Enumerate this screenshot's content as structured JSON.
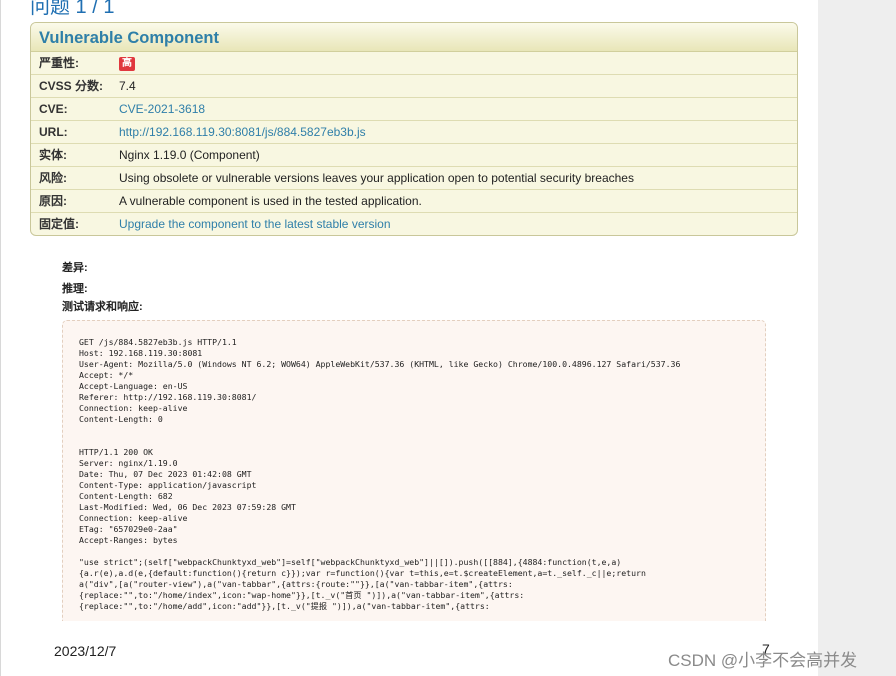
{
  "top_heading": "问题 1 / 1",
  "vuln": {
    "title": "Vulnerable Component",
    "rows": [
      {
        "key": "严重性:",
        "value": "",
        "badge": "高"
      },
      {
        "key": "CVSS 分数:",
        "value": "7.4"
      },
      {
        "key": "CVE:",
        "value": "CVE-2021-3618",
        "link": true
      },
      {
        "key": "URL:",
        "value": "http://192.168.119.30:8081/js/884.5827eb3b.js",
        "link": true
      },
      {
        "key": "实体:",
        "value": "Nginx 1.19.0 (Component)"
      },
      {
        "key": "风险:",
        "value": "Using obsolete or vulnerable versions leaves your application open to potential security breaches"
      },
      {
        "key": "原因:",
        "value": "A vulnerable component is used in the tested application."
      },
      {
        "key": "固定值:",
        "value": "Upgrade the component to the latest stable version",
        "link": true
      }
    ]
  },
  "labels": {
    "difference": "差异:",
    "reasoning": "推理:",
    "request_response": "测试请求和响应:"
  },
  "http": {
    "request": [
      "GET /js/884.5827eb3b.js HTTP/1.1",
      "Host: 192.168.119.30:8081",
      "User-Agent: Mozilla/5.0 (Windows NT 6.2; WOW64) AppleWebKit/537.36 (KHTML, like Gecko) Chrome/100.0.4896.127 Safari/537.36",
      "Accept: */*",
      "Accept-Language: en-US",
      "Referer: http://192.168.119.30:8081/",
      "Connection: keep-alive",
      "Content-Length: 0"
    ],
    "response": [
      "HTTP/1.1 200 OK",
      "Server: nginx/1.19.0",
      "Date: Thu, 07 Dec 2023 01:42:08 GMT",
      "Content-Type: application/javascript",
      "Content-Length: 682",
      "Last-Modified: Wed, 06 Dec 2023 07:59:28 GMT",
      "Connection: keep-alive",
      "ETag: \"657029e0-2aa\"",
      "Accept-Ranges: bytes"
    ],
    "body": [
      "\"use strict\";(self[\"webpackChunktyxd_web\"]=self[\"webpackChunktyxd_web\"]||[]).push([[884],{4884:function(t,e,a)",
      "{a.r(e),a.d(e,{default:function(){return c}});var r=function(){var t=this,e=t.$createElement,a=t._self._c||e;return",
      "a(\"div\",[a(\"router-view\"),a(\"van-tabbar\",{attrs:{route:\"\"}},[a(\"van-tabbar-item\",{attrs:",
      "{replace:\"\",to:\"/home/index\",icon:\"wap-home\"}},[t._v(\"首页 \")]),a(\"van-tabbar-item\",{attrs:",
      "{replace:\"\",to:\"/home/add\",icon:\"add\"}},[t._v(\"提报 \")]),a(\"van-tabbar-item\",{attrs:"
    ]
  },
  "footer": {
    "date": "2023/12/7",
    "page": "7"
  },
  "watermark": "CSDN @小李不会高并发"
}
